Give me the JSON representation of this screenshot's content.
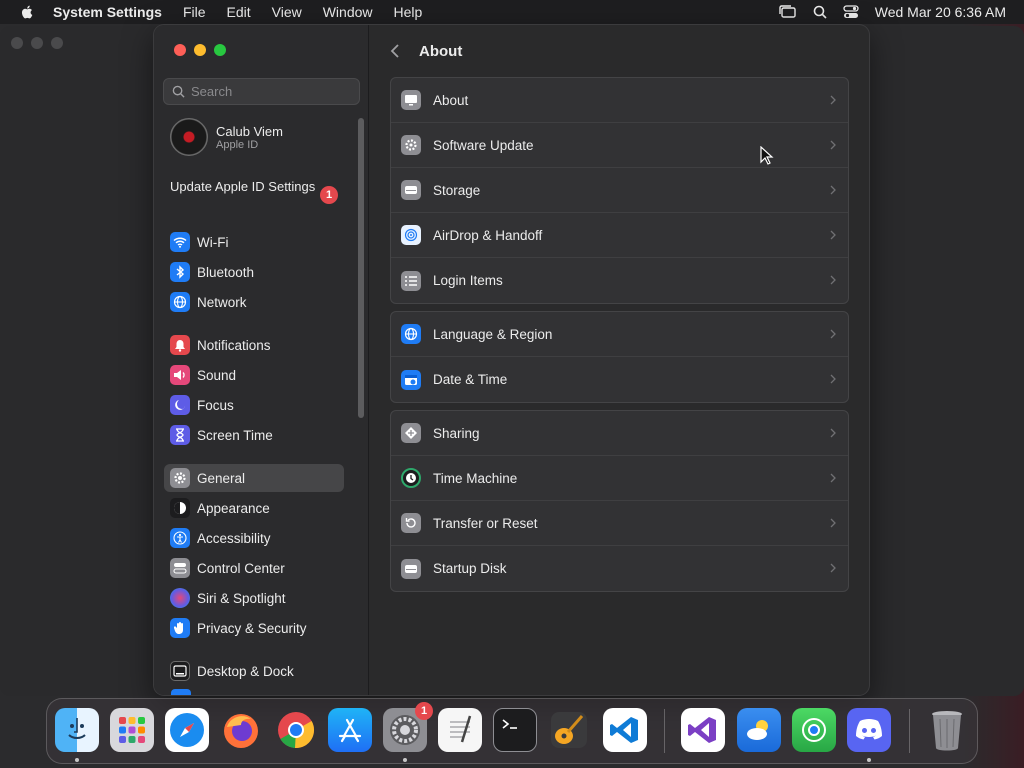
{
  "menubar": {
    "app_name": "System Settings",
    "menus": [
      "File",
      "Edit",
      "View",
      "Window",
      "Help"
    ],
    "clock": "Wed Mar 20  6:36 AM"
  },
  "sidebar": {
    "search_placeholder": "Search",
    "account": {
      "name": "Calub Viem",
      "subtitle": "Apple ID"
    },
    "update_item": {
      "label": "Update Apple ID Settings",
      "badge": "1"
    },
    "items": [
      {
        "label": "Wi-Fi",
        "icon": "wifi-icon",
        "color": "#1f7cf5"
      },
      {
        "label": "Bluetooth",
        "icon": "bluetooth-icon",
        "color": "#1f7cf5"
      },
      {
        "label": "Network",
        "icon": "globe-icon",
        "color": "#1f7cf5"
      },
      {
        "label": "Notifications",
        "icon": "bell-icon",
        "color": "#e5484d"
      },
      {
        "label": "Sound",
        "icon": "speaker-icon",
        "color": "#e5487a"
      },
      {
        "label": "Focus",
        "icon": "moon-icon",
        "color": "#5e5ce6"
      },
      {
        "label": "Screen Time",
        "icon": "hourglass-icon",
        "color": "#5e5ce6"
      },
      {
        "label": "General",
        "icon": "gear-icon",
        "color": "#8e8e93",
        "selected": true
      },
      {
        "label": "Appearance",
        "icon": "appearance-icon",
        "color": "#1c1c1e"
      },
      {
        "label": "Accessibility",
        "icon": "accessibility-icon",
        "color": "#1f7cf5"
      },
      {
        "label": "Control Center",
        "icon": "control-center-icon",
        "color": "#8e8e93"
      },
      {
        "label": "Siri & Spotlight",
        "icon": "siri-icon",
        "color": "#b04dd6"
      },
      {
        "label": "Privacy & Security",
        "icon": "hand-icon",
        "color": "#1f7cf5"
      },
      {
        "label": "Desktop & Dock",
        "icon": "dock-icon",
        "color": "#1c1c1e"
      }
    ]
  },
  "content": {
    "title": "About",
    "groups": [
      [
        {
          "label": "About",
          "icon": "display-icon"
        },
        {
          "label": "Software Update",
          "icon": "gear-update-icon"
        },
        {
          "label": "Storage",
          "icon": "disk-icon"
        },
        {
          "label": "AirDrop & Handoff",
          "icon": "airdrop-icon"
        },
        {
          "label": "Login Items",
          "icon": "list-icon"
        }
      ],
      [
        {
          "label": "Language & Region",
          "icon": "globe-icon"
        },
        {
          "label": "Date & Time",
          "icon": "calendar-clock-icon"
        }
      ],
      [
        {
          "label": "Sharing",
          "icon": "sharing-icon"
        },
        {
          "label": "Time Machine",
          "icon": "time-machine-icon"
        },
        {
          "label": "Transfer or Reset",
          "icon": "reset-icon"
        },
        {
          "label": "Startup Disk",
          "icon": "startup-disk-icon"
        }
      ]
    ]
  },
  "dock": {
    "apps": [
      {
        "name": "Finder",
        "running": true
      },
      {
        "name": "Launchpad",
        "running": false
      },
      {
        "name": "Safari",
        "running": false
      },
      {
        "name": "Firefox",
        "running": false
      },
      {
        "name": "Chrome",
        "running": false
      },
      {
        "name": "App Store",
        "running": false
      },
      {
        "name": "System Settings",
        "running": true,
        "badge": "1"
      },
      {
        "name": "TextEdit",
        "running": false
      },
      {
        "name": "Terminal",
        "running": false
      },
      {
        "name": "GarageBand",
        "running": false
      },
      {
        "name": "Visual Studio Code",
        "running": false
      },
      {
        "name": "Visual Studio",
        "running": false
      },
      {
        "name": "Weather",
        "running": false
      },
      {
        "name": "Find My",
        "running": false
      },
      {
        "name": "Discord",
        "running": true
      },
      {
        "name": "Trash",
        "running": false
      }
    ]
  }
}
